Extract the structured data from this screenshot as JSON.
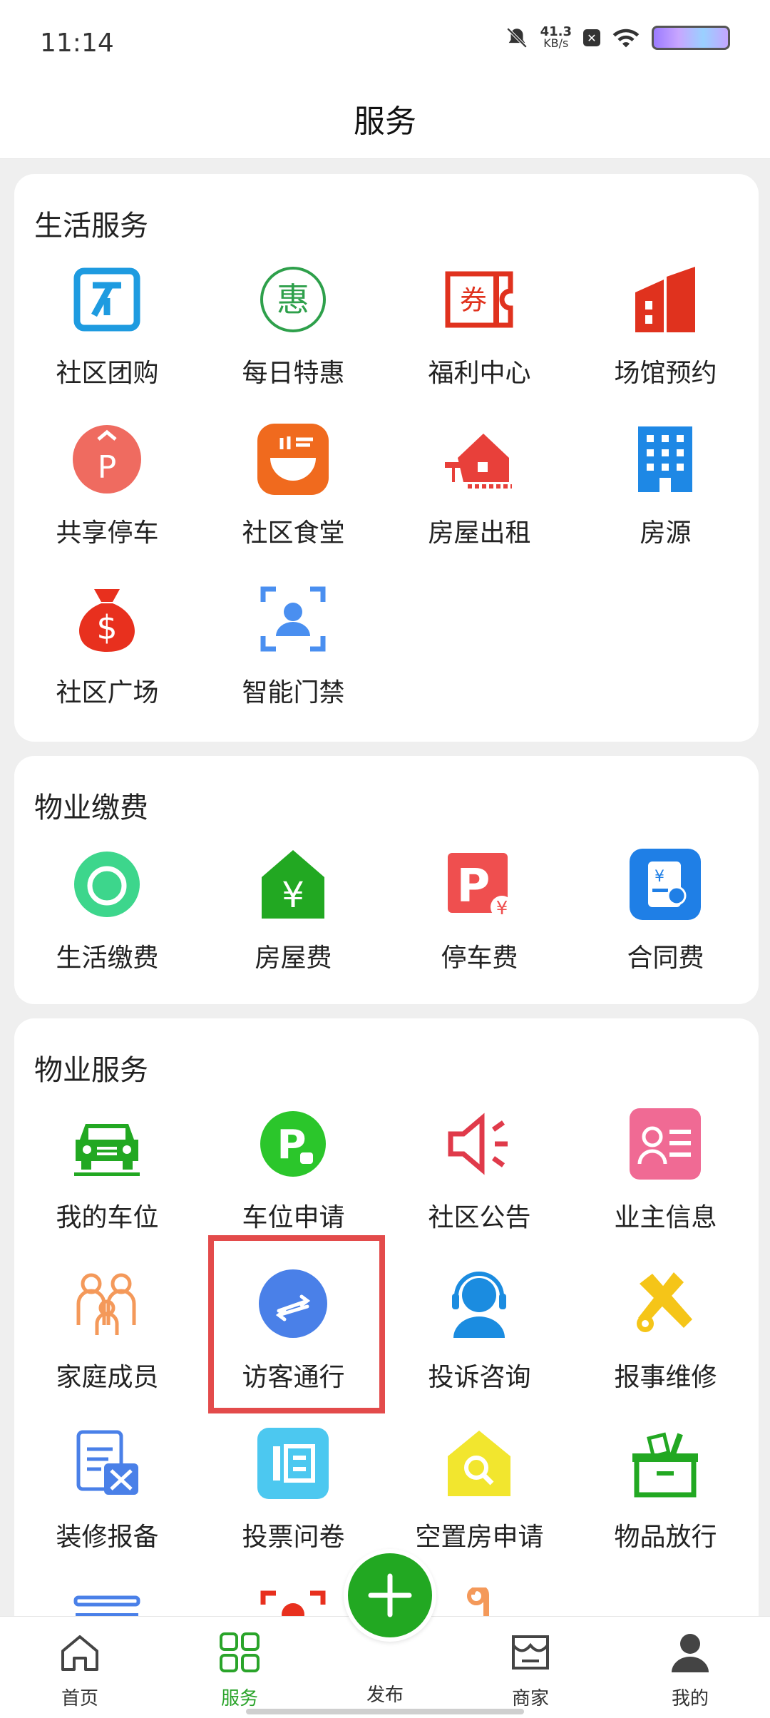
{
  "status_bar": {
    "time": "11:14",
    "speed_value": "41.3",
    "speed_unit": "KB/s"
  },
  "header": {
    "title": "服务"
  },
  "life": {
    "title": "生活服务",
    "items": [
      {
        "label": "社区团购"
      },
      {
        "label": "每日特惠",
        "glyph": "惠"
      },
      {
        "label": "福利中心",
        "glyph": "券"
      },
      {
        "label": "场馆预约"
      },
      {
        "label": "共享停车",
        "glyph": "P"
      },
      {
        "label": "社区食堂"
      },
      {
        "label": "房屋出租"
      },
      {
        "label": "房源"
      },
      {
        "label": "社区广场",
        "glyph": "$"
      },
      {
        "label": "智能门禁"
      }
    ]
  },
  "fee": {
    "title": "物业缴费",
    "items": [
      {
        "label": "生活缴费"
      },
      {
        "label": "房屋费",
        "glyph": "¥"
      },
      {
        "label": "停车费",
        "glyph": "P",
        "glyph2": "¥"
      },
      {
        "label": "合同费",
        "glyph": "¥"
      }
    ]
  },
  "property": {
    "title": "物业服务",
    "items": [
      {
        "label": "我的车位"
      },
      {
        "label": "车位申请",
        "glyph": "P"
      },
      {
        "label": "社区公告"
      },
      {
        "label": "业主信息"
      },
      {
        "label": "家庭成员"
      },
      {
        "label": "访客通行"
      },
      {
        "label": "投诉咨询"
      },
      {
        "label": "报事维修"
      },
      {
        "label": "装修报备"
      },
      {
        "label": "投票问卷"
      },
      {
        "label": "空置房申请"
      },
      {
        "label": "物品放行"
      }
    ]
  },
  "nav": [
    {
      "label": "首页"
    },
    {
      "label": "服务"
    },
    {
      "label": "发布"
    },
    {
      "label": "商家"
    },
    {
      "label": "我的"
    }
  ]
}
